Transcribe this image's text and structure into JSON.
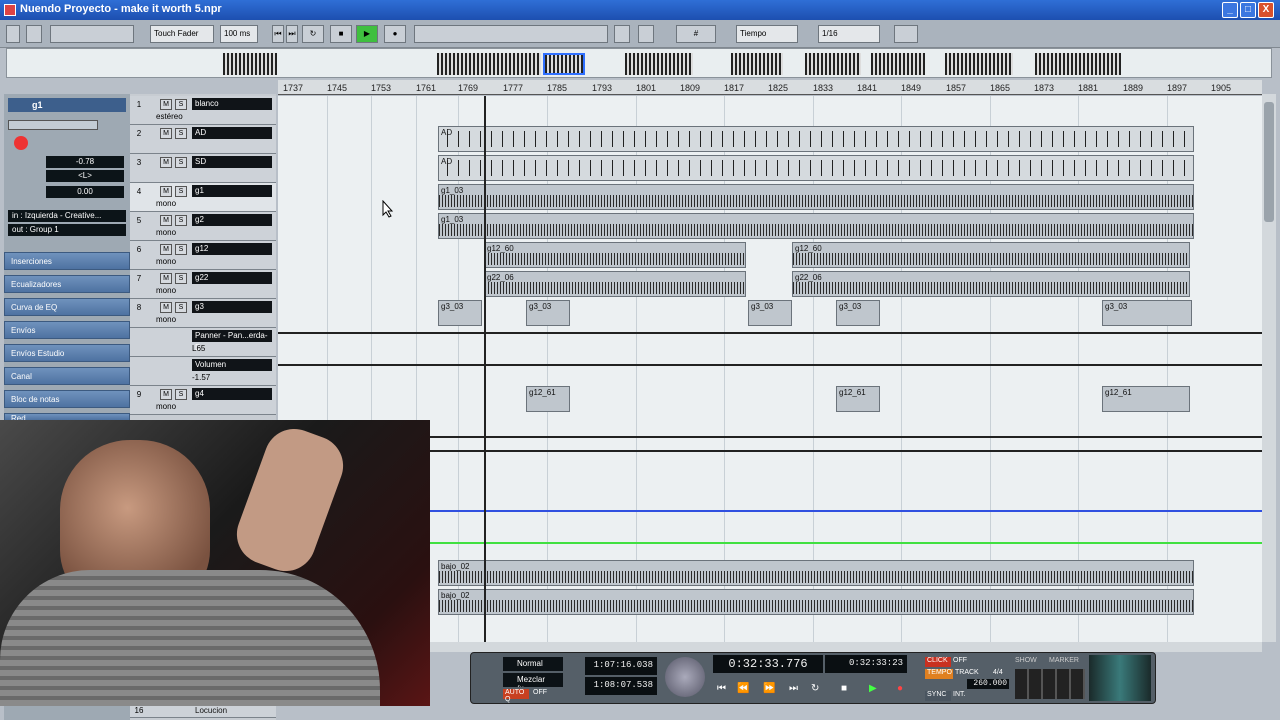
{
  "window": {
    "title": "Nuendo Proyecto - make it worth 5.npr",
    "minimize": "_",
    "maximize": "□",
    "close": "X"
  },
  "toolbar": {
    "automation_mode": "Touch Fader",
    "nudge": "100 ms",
    "snap_type": "Tiempo",
    "quantize": "1/16"
  },
  "ruler": {
    "ticks": [
      "1737",
      "1745",
      "1753",
      "1761",
      "1769",
      "1777",
      "1785",
      "1793",
      "1801",
      "1809",
      "1817",
      "1825",
      "1833",
      "1841",
      "1849",
      "1857",
      "1865",
      "1873",
      "1881",
      "1889",
      "1897",
      "1905"
    ]
  },
  "inspector": {
    "track_name": "g1",
    "volume": "-0.78",
    "pan": "<L>",
    "delay": "0.00",
    "input": "in : Izquierda - Creative...",
    "output": "out : Group 1",
    "sections": [
      "Inserciones",
      "Ecualizadores",
      "Curva de EQ",
      "Envíos",
      "Envíos Estudio",
      "Canal",
      "Bloc de notas",
      "Red"
    ]
  },
  "tracks": [
    {
      "num": "1",
      "name": "blanco",
      "mode": "estéreo"
    },
    {
      "num": "2",
      "name": "AD",
      "mode": ""
    },
    {
      "num": "3",
      "name": "SD",
      "mode": ""
    },
    {
      "num": "4",
      "name": "g1",
      "mode": "mono"
    },
    {
      "num": "5",
      "name": "g2",
      "mode": "mono"
    },
    {
      "num": "6",
      "name": "g12",
      "mode": "mono"
    },
    {
      "num": "7",
      "name": "g22",
      "mode": "mono"
    },
    {
      "num": "8",
      "name": "g3",
      "mode": "mono"
    },
    {
      "num": "",
      "name": "Panner - Pan...erda-D",
      "mode": "L65"
    },
    {
      "num": "",
      "name": "Volumen",
      "mode": "-1.57"
    },
    {
      "num": "9",
      "name": "g4",
      "mode": "mono"
    },
    {
      "num": "16",
      "name": "Locucion",
      "mode": ""
    }
  ],
  "events": {
    "ad": "AD",
    "g1": "g1_03",
    "g12": "g12_60",
    "g22": "g22_06",
    "g3": "g3_03",
    "g4": "g12_61",
    "bajo": "bajo_02"
  },
  "transport": {
    "mode1": "Normal",
    "mode2": "Mezclar (x-",
    "autoq": "AUTO Q",
    "autoq_state": "OFF",
    "left_locator": "1:07:16.038",
    "right_locator": "1:08:07.538",
    "position": "0:32:33.776",
    "secondary": "0:32:33:23",
    "click": "CLICK",
    "click_state": "OFF",
    "tempo": "TEMPO",
    "tempo_mode": "TRACK",
    "signature": "4/4",
    "bpm": "260.000",
    "sync": "SYNC",
    "sync_state": "INT.",
    "show": "SHOW",
    "marker": "MARKER"
  }
}
